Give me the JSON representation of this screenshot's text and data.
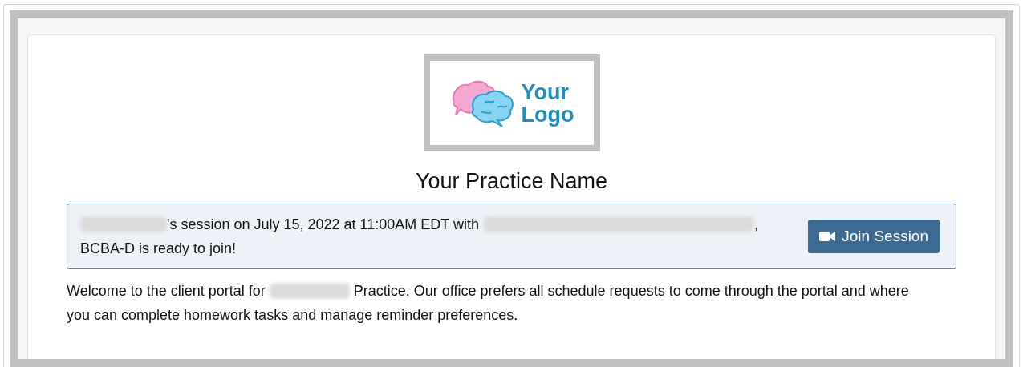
{
  "logo": {
    "lines": [
      "Your",
      "Logo"
    ]
  },
  "practice_name": "Your Practice Name",
  "session_alert": {
    "lines": [
      [
        {
          "kind": "redacted"
        },
        {
          "kind": "text",
          "text": "'s session on July 15, 2022 at 11:00AM EDT with "
        },
        {
          "kind": "redacted"
        },
        {
          "kind": "text",
          "text": ","
        }
      ],
      [
        {
          "kind": "text",
          "text": "BCBA-D is ready to join!"
        }
      ]
    ],
    "button": "Join Session"
  },
  "welcome": {
    "lines": [
      [
        {
          "kind": "text",
          "text": "Welcome to the client portal for "
        },
        {
          "kind": "redacted"
        },
        {
          "kind": "text",
          "text": " Practice. Our office prefers all schedule requests to come through the portal and where"
        }
      ],
      [
        {
          "kind": "text",
          "text": "you can complete homework tasks and manage reminder preferences."
        }
      ]
    ]
  }
}
